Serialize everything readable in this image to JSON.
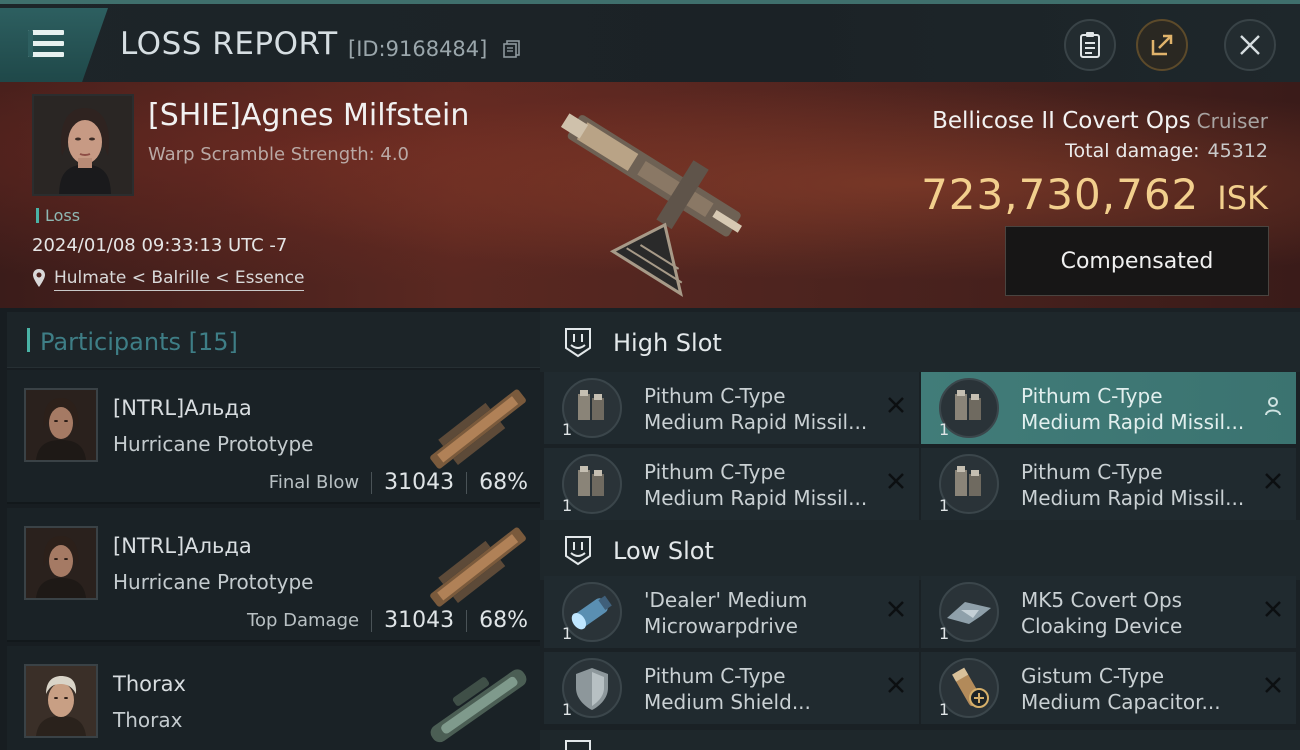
{
  "header": {
    "title": "LOSS REPORT",
    "report_id": "[ID:9168484]"
  },
  "victim": {
    "name": "[SHIE]Agnes Milfstein",
    "attribute": "Warp Scramble Strength: 4.0",
    "status": "Loss",
    "timestamp": "2024/01/08 09:33:13 UTC -7",
    "location": "Hulmate < Balrille < Essence",
    "ship_name": "Bellicose II Covert Ops",
    "ship_class": "Cruiser",
    "total_damage_label": "Total damage:",
    "total_damage": "45312",
    "isk_value": "723,730,762",
    "isk_unit": "ISK",
    "compensated_label": "Compensated"
  },
  "participants": {
    "title": "Participants",
    "count": "[15]",
    "items": [
      {
        "name": "[NTRL]Альда",
        "ship": "Hurricane Prototype",
        "tag": "Final Blow",
        "damage": "31043",
        "percent": "68%"
      },
      {
        "name": "[NTRL]Альда",
        "ship": "Hurricane Prototype",
        "tag": "Top Damage",
        "damage": "31043",
        "percent": "68%"
      },
      {
        "name": "Thorax",
        "ship": "Thorax",
        "tag": "",
        "damage": "",
        "percent": ""
      }
    ]
  },
  "fitting": {
    "high_slot": {
      "title": "High Slot",
      "modules": [
        {
          "qty": "1",
          "line1": "Pithum C-Type",
          "line2": "Medium Rapid Missil..."
        },
        {
          "qty": "1",
          "line1": "Pithum C-Type",
          "line2": "Medium Rapid Missil..."
        },
        {
          "qty": "1",
          "line1": "Pithum C-Type",
          "line2": "Medium Rapid Missil..."
        },
        {
          "qty": "1",
          "line1": "Pithum C-Type",
          "line2": "Medium Rapid Missil..."
        }
      ]
    },
    "low_slot": {
      "title": "Low Slot",
      "modules": [
        {
          "qty": "1",
          "line1": "'Dealer' Medium",
          "line2": "Microwarpdrive"
        },
        {
          "qty": "1",
          "line1": "MK5 Covert Ops",
          "line2": "Cloaking Device"
        },
        {
          "qty": "1",
          "line1": "Pithum C-Type",
          "line2": "Medium Shield..."
        },
        {
          "qty": "1",
          "line1": "Gistum C-Type",
          "line2": "Medium Capacitor..."
        }
      ]
    }
  },
  "colors": {
    "accent_teal": "#4ab3a6",
    "isk_gold": "#f2cf8d",
    "active_module": "#417c79"
  }
}
